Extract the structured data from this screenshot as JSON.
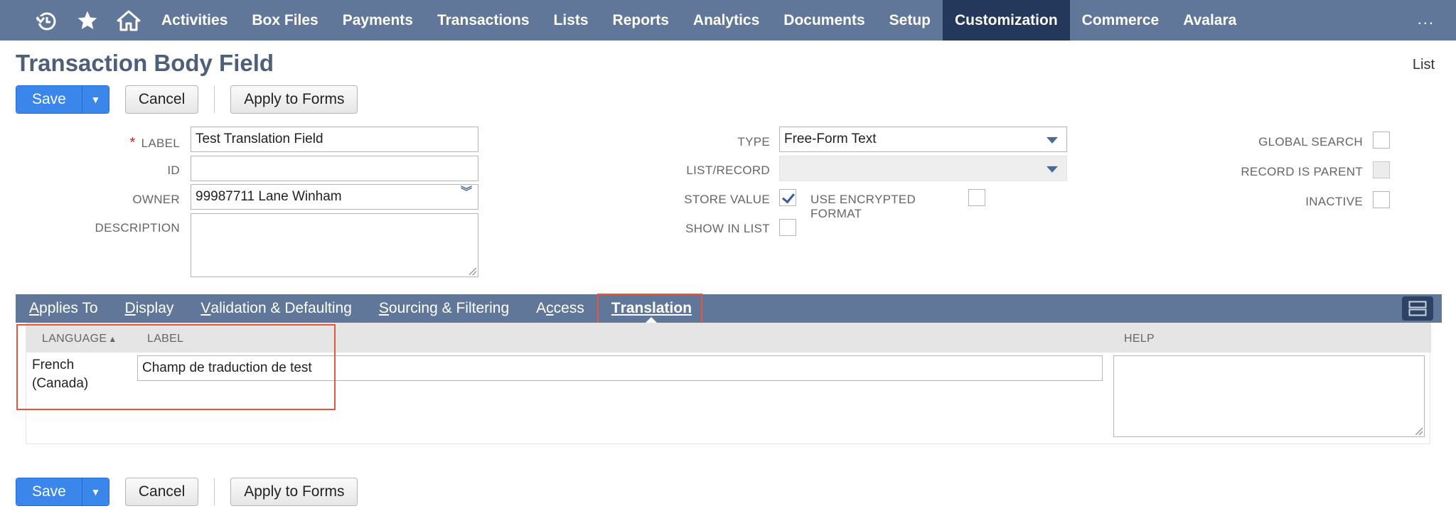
{
  "nav": {
    "items": [
      "Activities",
      "Box Files",
      "Payments",
      "Transactions",
      "Lists",
      "Reports",
      "Analytics",
      "Documents",
      "Setup",
      "Customization",
      "Commerce",
      "Avalara"
    ],
    "active": "Customization",
    "more": "..."
  },
  "page": {
    "title": "Transaction Body Field",
    "list_link": "List"
  },
  "buttons": {
    "save": "Save",
    "cancel": "Cancel",
    "apply": "Apply to Forms"
  },
  "form": {
    "label_label": "LABEL",
    "label_value": "Test Translation Field",
    "id_label": "ID",
    "id_value": "",
    "owner_label": "OWNER",
    "owner_value": "99987711 Lane Winham",
    "description_label": "DESCRIPTION",
    "type_label": "TYPE",
    "type_value": "Free-Form Text",
    "list_record_label": "LIST/RECORD",
    "list_record_value": "",
    "store_value_label": "STORE VALUE",
    "store_value_checked": true,
    "use_encrypted_label": "USE ENCRYPTED FORMAT",
    "show_in_list_label": "SHOW IN LIST",
    "global_search_label": "GLOBAL SEARCH",
    "record_is_parent_label": "RECORD IS PARENT",
    "inactive_label": "INACTIVE"
  },
  "tabs": [
    {
      "u": "A",
      "rest": "pplies To"
    },
    {
      "u": "D",
      "rest": "isplay"
    },
    {
      "u": "V",
      "rest": "alidation & Defaulting"
    },
    {
      "u": "S",
      "rest": "ourcing & Filtering"
    },
    {
      "pre": "A",
      "u": "c",
      "rest": "cess"
    },
    {
      "u": "T",
      "rest": "ranslation"
    }
  ],
  "translation": {
    "col_language": "LANGUAGE",
    "sort_arrow": "▲",
    "col_label": "LABEL",
    "col_help": "HELP",
    "row": {
      "language_line1": "French",
      "language_line2": "(Canada)",
      "label": "Champ de traduction de test",
      "help": ""
    }
  },
  "colors": {
    "nav_bg": "#607799",
    "nav_active": "#24385b",
    "primary": "#3b86ea",
    "highlight": "#e4573d"
  }
}
